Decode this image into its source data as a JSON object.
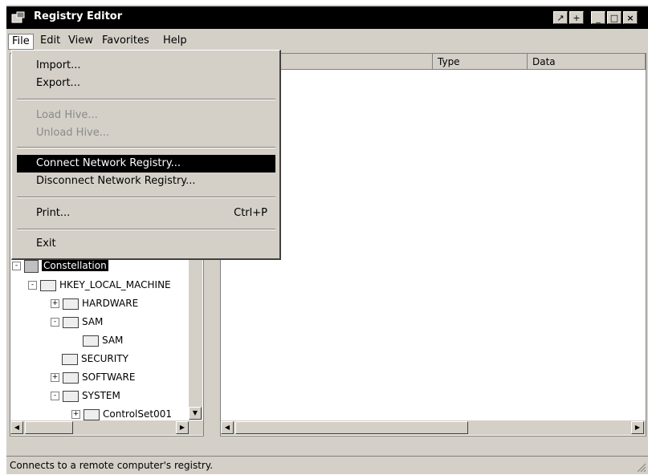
{
  "window": {
    "title": "Registry Editor",
    "controls": [
      "restore",
      "help",
      "minimize",
      "maximize",
      "close"
    ]
  },
  "menubar": {
    "items": [
      "File",
      "Edit",
      "View",
      "Favorites",
      "Help"
    ]
  },
  "file_menu": {
    "items": [
      {
        "label": "Import...",
        "enabled": true
      },
      {
        "label": "Export...",
        "enabled": true
      },
      {
        "label": "Load Hive...",
        "enabled": false
      },
      {
        "label": "Unload Hive...",
        "enabled": false
      },
      {
        "label": "Connect Network Registry...",
        "enabled": true,
        "highlighted": true
      },
      {
        "label": "Disconnect Network Registry...",
        "enabled": true
      },
      {
        "label": "Print...",
        "shortcut": "Ctrl+P",
        "enabled": true
      },
      {
        "label": "Exit",
        "enabled": true
      }
    ]
  },
  "list_columns": [
    "Type",
    "Data"
  ],
  "tree": {
    "root": "Constellation",
    "nodes": [
      {
        "label": "HKEY_LOCAL_MACHINE",
        "expander": "-"
      },
      {
        "label": "HARDWARE",
        "expander": "+"
      },
      {
        "label": "SAM",
        "expander": "-"
      },
      {
        "label": "SAM",
        "expander": ""
      },
      {
        "label": "SECURITY",
        "expander": ""
      },
      {
        "label": "SOFTWARE",
        "expander": "+"
      },
      {
        "label": "SYSTEM",
        "expander": "-"
      },
      {
        "label": "ControlSet001",
        "expander": "+"
      }
    ]
  },
  "status": {
    "text": "Connects to a remote computer's registry."
  }
}
